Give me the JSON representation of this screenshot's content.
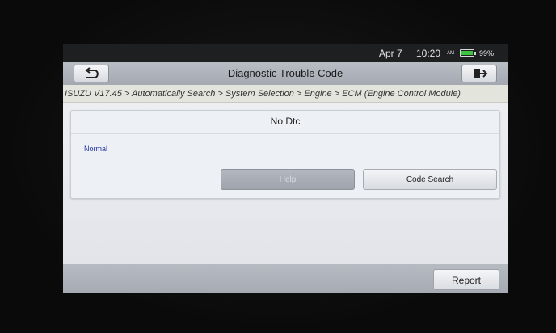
{
  "status": {
    "date": "Apr 7",
    "time": "10:20",
    "ampm": "AM",
    "battery": "99%",
    "battery_level": 0.99
  },
  "titlebar": {
    "title": "Diagnostic Trouble Code",
    "back_icon": "back-arrow-icon",
    "exit_icon": "exit-door-icon"
  },
  "breadcrumb": "ISUZU V17.45 > Automatically Search > System Selection > Engine > ECM (Engine Control Module)",
  "card": {
    "header": "No Dtc",
    "status": "Normal",
    "help_label": "Help",
    "code_search_label": "Code Search"
  },
  "bottombar": {
    "report_label": "Report"
  },
  "colors": {
    "accent_status": "#2333a0",
    "battery": "#3ec43e"
  }
}
